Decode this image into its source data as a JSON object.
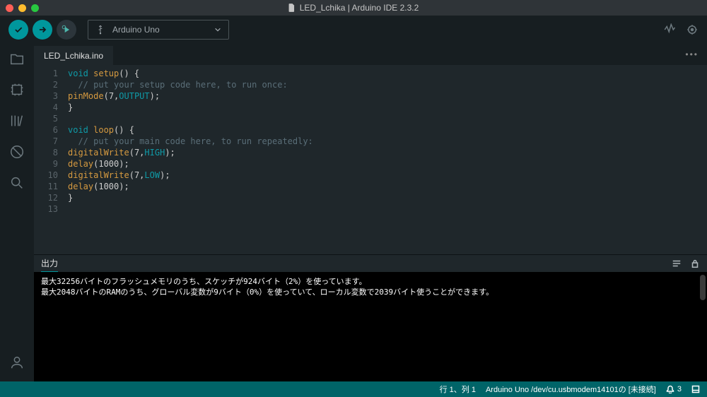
{
  "window": {
    "title": "LED_Lchika | Arduino IDE 2.3.2"
  },
  "toolbar": {
    "board_name": "Arduino Uno"
  },
  "tabs": {
    "active": "LED_Lchika.ino"
  },
  "code": {
    "lines": [
      {
        "n": "1",
        "t": [
          [
            "kw",
            "void "
          ],
          [
            "fn",
            "setup"
          ],
          [
            "paren",
            "() {"
          ]
        ]
      },
      {
        "n": "2",
        "t": [
          [
            "plain",
            "  "
          ],
          [
            "comment",
            "// put your setup code here, to run once:"
          ]
        ]
      },
      {
        "n": "3",
        "t": [
          [
            "call",
            "pinMode"
          ],
          [
            "paren",
            "("
          ],
          [
            "num",
            "7"
          ],
          [
            "paren",
            ","
          ],
          [
            "const",
            "OUTPUT"
          ],
          [
            "paren",
            ");"
          ]
        ]
      },
      {
        "n": "4",
        "t": [
          [
            "paren",
            "}"
          ]
        ]
      },
      {
        "n": "5",
        "t": [
          [
            "plain",
            ""
          ]
        ]
      },
      {
        "n": "6",
        "t": [
          [
            "kw",
            "void "
          ],
          [
            "fn",
            "loop"
          ],
          [
            "paren",
            "() {"
          ]
        ]
      },
      {
        "n": "7",
        "t": [
          [
            "plain",
            "  "
          ],
          [
            "comment",
            "// put your main code here, to run repeatedly:"
          ]
        ]
      },
      {
        "n": "8",
        "t": [
          [
            "call",
            "digitalWrite"
          ],
          [
            "paren",
            "("
          ],
          [
            "num",
            "7"
          ],
          [
            "paren",
            ","
          ],
          [
            "const",
            "HIGH"
          ],
          [
            "paren",
            ");"
          ]
        ]
      },
      {
        "n": "9",
        "t": [
          [
            "call",
            "delay"
          ],
          [
            "paren",
            "("
          ],
          [
            "num",
            "1000"
          ],
          [
            "paren",
            ");"
          ]
        ]
      },
      {
        "n": "10",
        "t": [
          [
            "call",
            "digitalWrite"
          ],
          [
            "paren",
            "("
          ],
          [
            "num",
            "7"
          ],
          [
            "paren",
            ","
          ],
          [
            "const",
            "LOW"
          ],
          [
            "paren",
            ");"
          ]
        ]
      },
      {
        "n": "11",
        "t": [
          [
            "call",
            "delay"
          ],
          [
            "paren",
            "("
          ],
          [
            "num",
            "1000"
          ],
          [
            "paren",
            ");"
          ]
        ]
      },
      {
        "n": "12",
        "t": [
          [
            "paren",
            "}"
          ]
        ]
      },
      {
        "n": "13",
        "t": [
          [
            "plain",
            ""
          ]
        ]
      }
    ]
  },
  "panel": {
    "tab": "出力",
    "line1": "最大32256バイトのフラッシュメモリのうち、スケッチが924バイト（2%）を使っています。",
    "line2": "最大2048バイトのRAMのうち、グローバル変数が9バイト（0%）を使っていて、ローカル変数で2039バイト使うことができます。"
  },
  "statusbar": {
    "cursor": "行 1、列 1",
    "board": "Arduino Uno /dev/cu.usbmodem14101の [未接続]",
    "notif": "3"
  }
}
